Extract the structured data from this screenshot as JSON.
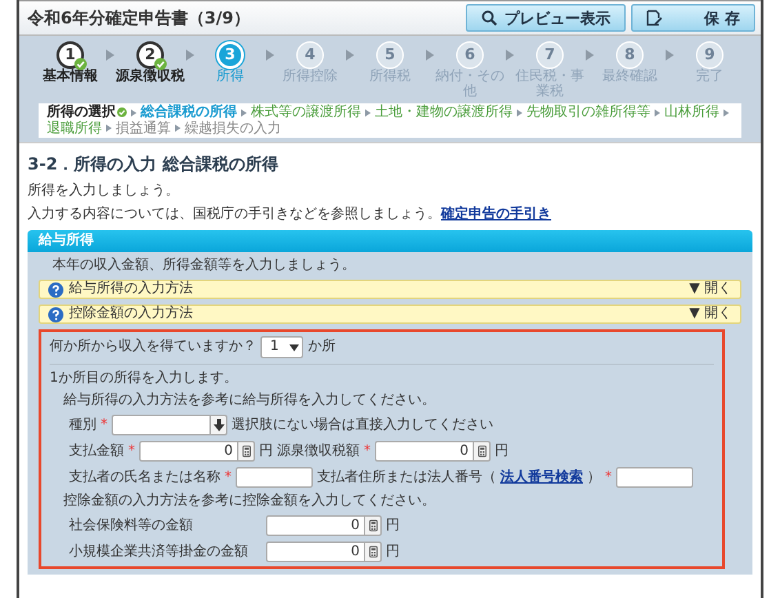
{
  "window": {
    "title": "令和6年分確定申告書（3/9）",
    "buttons": [
      {
        "label": "プレビュー表示",
        "kind": "preview"
      },
      {
        "label": "保 存",
        "kind": "save"
      }
    ]
  },
  "steps": [
    {
      "number": "1",
      "label": "基本情報",
      "done": true,
      "selected": false
    },
    {
      "number": "2",
      "label": "源泉徴収税",
      "done": true,
      "selected": false
    },
    {
      "number": "3",
      "label": "所得",
      "done": false,
      "selected": true
    },
    {
      "number": "4",
      "label": "所得控除",
      "done": false,
      "selected": false
    },
    {
      "number": "5",
      "label": "所得税",
      "done": false,
      "selected": false
    },
    {
      "number": "6",
      "label": "納付・その他",
      "done": false,
      "selected": false
    },
    {
      "number": "7",
      "label": "住民税・事業税",
      "done": false,
      "selected": false
    },
    {
      "number": "8",
      "label": "最終確認",
      "done": false,
      "selected": false
    },
    {
      "number": "9",
      "label": "完了",
      "done": false,
      "selected": false
    }
  ],
  "substeps": [
    {
      "label": "所得の選択",
      "done": true,
      "selected": false,
      "disabled": false
    },
    {
      "label": "総合課税の所得",
      "done": false,
      "selected": true,
      "disabled": false
    },
    {
      "label": "株式等の譲渡所得",
      "done": false,
      "selected": false,
      "disabled": false
    },
    {
      "label": "土地・建物の譲渡所得",
      "done": false,
      "selected": false,
      "disabled": false
    },
    {
      "label": "先物取引の雑所得等",
      "done": false,
      "selected": false,
      "disabled": false
    },
    {
      "label": "山林所得",
      "done": false,
      "selected": false,
      "disabled": false
    },
    {
      "label": "退職所得",
      "done": false,
      "selected": false,
      "disabled": false
    },
    {
      "label": "損益通算",
      "done": false,
      "selected": false,
      "disabled": true
    },
    {
      "label": "繰越損失の入力",
      "done": false,
      "selected": false,
      "disabled": true
    }
  ],
  "heading": "3-2．所得の入力 総合課税の所得",
  "intro": {
    "line": "所得を入力しましょう。",
    "guide": "入力する内容については、国税庁の手引きなどを参照しましょう。",
    "link": "確定申告の手引き"
  },
  "section": {
    "title": "給与所得",
    "note": "本年の収入金額、所得金額等を入力しましょう。",
    "accordions": [
      {
        "label": "給与所得の入力方法",
        "arrow": "▼",
        "toggle": "開く"
      },
      {
        "label": "控除金額の入力方法",
        "arrow": "▼",
        "toggle": "開く"
      }
    ],
    "count_question": {
      "label": "何か所から収入を得ていますか？",
      "value": "1",
      "unit": "か所"
    },
    "entry_title": "1か所目の所得を入力します。",
    "salary_note": "給与所得の入力方法を参考に給与所得を入力してください。",
    "salary_rows": [
      [
        {
          "label": "種別",
          "kind": "select",
          "required_mark": "*",
          "hint": "選択肢にない場合は直接入力してください"
        }
      ],
      [
        {
          "label": "支払金額",
          "kind": "amount",
          "required_mark": "*",
          "value": "0",
          "unit": "円"
        },
        {
          "label": "源泉徴収税額",
          "kind": "amount",
          "required_mark": "*",
          "value": "0",
          "unit": "円"
        }
      ],
      [
        {
          "label": "支払者の氏名または名称",
          "kind": "text",
          "required_mark": "*"
        },
        {
          "label": "支払者住所または法人番号（",
          "link": "法人番号検索",
          "label_end": "）",
          "kind": "text",
          "required_mark": "*"
        }
      ]
    ],
    "deduction_note": "控除金額の入力方法を参考に控除金額を入力してください。",
    "deduction_rows": [
      {
        "label": "社会保険料等の金額",
        "kind": "amount",
        "value": "0",
        "unit": "円"
      },
      {
        "label": "小規模企業共済等掛金の金額",
        "kind": "amount",
        "value": "0",
        "unit": "円"
      }
    ]
  }
}
